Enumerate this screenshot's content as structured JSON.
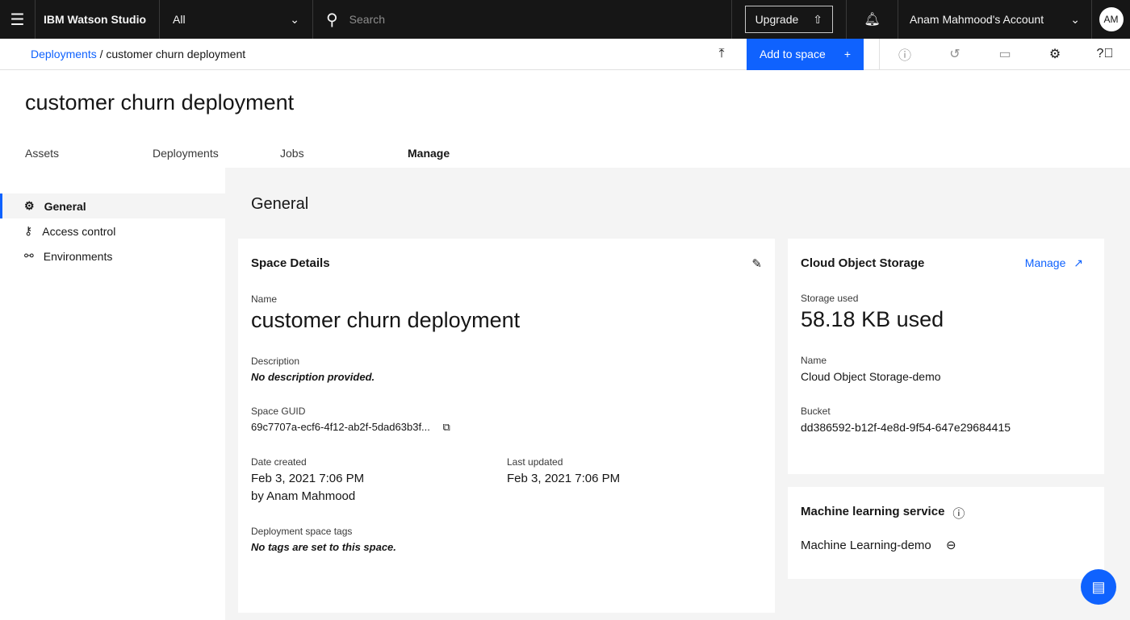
{
  "header": {
    "brand": "IBM Watson Studio",
    "scope": "All",
    "search_placeholder": "Search",
    "upgrade": "Upgrade",
    "account": "Anam Mahmood's Account",
    "avatar": "AM"
  },
  "breadcrumb": {
    "parent": "Deployments",
    "separator": "/",
    "current": "customer churn deployment"
  },
  "toolbar": {
    "add_to_space": "Add to space"
  },
  "page_title": "customer churn deployment",
  "tabs": [
    {
      "label": "Assets"
    },
    {
      "label": "Deployments"
    },
    {
      "label": "Jobs"
    },
    {
      "label": "Manage"
    }
  ],
  "sidebar": {
    "items": [
      {
        "label": "General"
      },
      {
        "label": "Access control"
      },
      {
        "label": "Environments"
      }
    ]
  },
  "main": {
    "title": "General"
  },
  "space_details": {
    "title": "Space Details",
    "name_label": "Name",
    "name": "customer churn deployment",
    "desc_label": "Description",
    "desc": "No description provided.",
    "guid_label": "Space GUID",
    "guid": "69c7707a-ecf6-4f12-ab2f-5dad63b3f...",
    "created_label": "Date created",
    "created": "Feb 3, 2021 7:06 PM",
    "created_by": "by Anam Mahmood",
    "updated_label": "Last updated",
    "updated": "Feb 3, 2021 7:06 PM",
    "tags_label": "Deployment space tags",
    "tags": "No tags are set to this space."
  },
  "cos": {
    "title": "Cloud Object Storage",
    "manage": "Manage",
    "used_label": "Storage used",
    "used": "58.18 KB used",
    "name_label": "Name",
    "name": "Cloud Object Storage-demo",
    "bucket_label": "Bucket",
    "bucket": "dd386592-b12f-4e8d-9f54-647e29684415"
  },
  "ml": {
    "title": "Machine learning service",
    "instance": "Machine Learning-demo"
  }
}
